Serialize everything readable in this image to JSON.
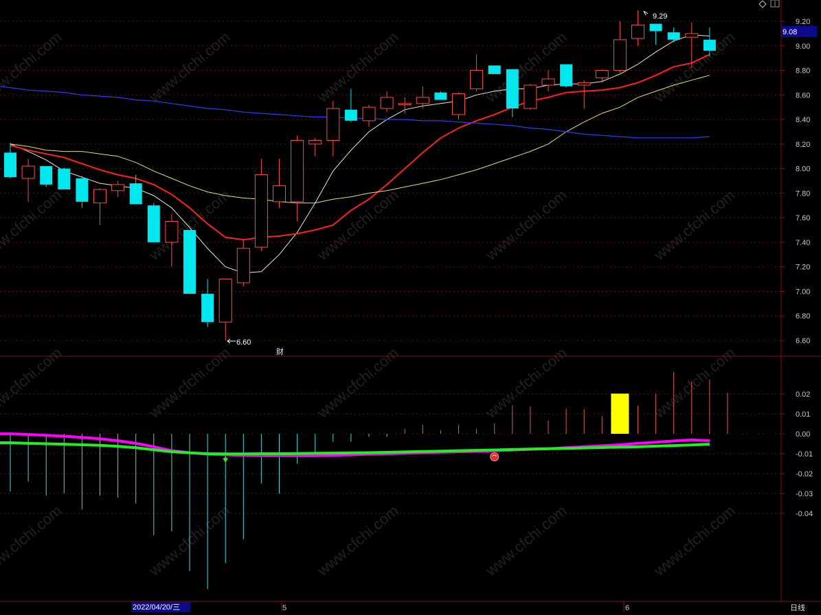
{
  "colors": {
    "background": "#000000",
    "up": "#ff4a4a",
    "down": "#00e8ee",
    "ma5": "#e8e8e8",
    "ma10": "#ff2020",
    "ma20": "#e8e070",
    "ma60": "#2a3cff",
    "grid": "#6a1010",
    "hist_pos": "#e25858",
    "hist_neg": "#44d8e0",
    "hist_highlight": "#ffff00",
    "line_magenta": "#ff00ff",
    "line_green": "#22ee22"
  },
  "toolbar": {
    "diamond_icon": "diamond-icon",
    "menu_icon": "menu-icon"
  },
  "price_tag": "9.08",
  "period_label": "日线",
  "watermark": "www.cfchi.com",
  "x_axis": {
    "date_label": "2022/04/20/三",
    "month_labels": [
      "5",
      "6"
    ]
  },
  "markers": {
    "high_label": "9.29",
    "low_label": "6.60",
    "finance_label": "财"
  },
  "chart_data": [
    {
      "type": "candlestick",
      "title": "",
      "ylim": [
        6.5,
        9.25
      ],
      "y_ticks": [
        "9.20",
        "9.00",
        "8.80",
        "8.60",
        "8.40",
        "8.20",
        "8.00",
        "7.80",
        "7.60",
        "7.40",
        "7.20",
        "7.00",
        "6.80",
        "6.60"
      ],
      "candles": [
        {
          "open": 8.13,
          "high": 8.21,
          "low": 7.92,
          "close": 7.93
        },
        {
          "open": 7.92,
          "high": 8.08,
          "low": 7.73,
          "close": 8.02
        },
        {
          "open": 8.02,
          "high": 8.02,
          "low": 7.85,
          "close": 7.87
        },
        {
          "open": 8.0,
          "high": 8.01,
          "low": 7.83,
          "close": 7.83
        },
        {
          "open": 7.92,
          "high": 7.94,
          "low": 7.68,
          "close": 7.73
        },
        {
          "open": 7.72,
          "high": 7.84,
          "low": 7.54,
          "close": 7.83
        },
        {
          "open": 7.82,
          "high": 7.9,
          "low": 7.77,
          "close": 7.87
        },
        {
          "open": 7.88,
          "high": 7.95,
          "low": 7.71,
          "close": 7.71
        },
        {
          "open": 7.7,
          "high": 7.72,
          "low": 7.4,
          "close": 7.4
        },
        {
          "open": 7.4,
          "high": 7.63,
          "low": 7.2,
          "close": 7.57
        },
        {
          "open": 7.5,
          "high": 7.5,
          "low": 6.98,
          "close": 6.98
        },
        {
          "open": 6.98,
          "high": 7.1,
          "low": 6.71,
          "close": 6.75
        },
        {
          "open": 6.75,
          "high": 7.1,
          "low": 6.6,
          "close": 7.1
        },
        {
          "open": 7.07,
          "high": 7.42,
          "low": 7.04,
          "close": 7.35
        },
        {
          "open": 7.36,
          "high": 8.08,
          "low": 7.33,
          "close": 7.95
        },
        {
          "open": 7.73,
          "high": 8.08,
          "low": 7.68,
          "close": 7.86
        },
        {
          "open": 7.73,
          "high": 8.27,
          "low": 7.57,
          "close": 8.23
        },
        {
          "open": 8.2,
          "high": 8.25,
          "low": 8.1,
          "close": 8.23
        },
        {
          "open": 8.23,
          "high": 8.55,
          "low": 8.1,
          "close": 8.49
        },
        {
          "open": 8.48,
          "high": 8.65,
          "low": 8.38,
          "close": 8.39
        },
        {
          "open": 8.39,
          "high": 8.52,
          "low": 8.34,
          "close": 8.5
        },
        {
          "open": 8.49,
          "high": 8.63,
          "low": 8.46,
          "close": 8.58
        },
        {
          "open": 8.52,
          "high": 8.58,
          "low": 8.45,
          "close": 8.53
        },
        {
          "open": 8.53,
          "high": 8.67,
          "low": 8.49,
          "close": 8.58
        },
        {
          "open": 8.62,
          "high": 8.63,
          "low": 8.56,
          "close": 8.56
        },
        {
          "open": 8.44,
          "high": 8.62,
          "low": 8.4,
          "close": 8.61
        },
        {
          "open": 8.65,
          "high": 8.93,
          "low": 8.63,
          "close": 8.8
        },
        {
          "open": 8.84,
          "high": 8.84,
          "low": 8.77,
          "close": 8.77
        },
        {
          "open": 8.81,
          "high": 8.81,
          "low": 8.42,
          "close": 8.49
        },
        {
          "open": 8.49,
          "high": 8.69,
          "low": 8.48,
          "close": 8.68
        },
        {
          "open": 8.68,
          "high": 8.8,
          "low": 8.63,
          "close": 8.73
        },
        {
          "open": 8.85,
          "high": 8.85,
          "low": 8.66,
          "close": 8.67
        },
        {
          "open": 8.68,
          "high": 8.72,
          "low": 8.49,
          "close": 8.7
        },
        {
          "open": 8.74,
          "high": 8.81,
          "low": 8.7,
          "close": 8.8
        },
        {
          "open": 8.8,
          "high": 9.2,
          "low": 8.78,
          "close": 9.05
        },
        {
          "open": 9.06,
          "high": 9.29,
          "low": 9.0,
          "close": 9.17
        },
        {
          "open": 9.18,
          "high": 9.18,
          "low": 9.01,
          "close": 9.12
        },
        {
          "open": 9.11,
          "high": 9.15,
          "low": 9.03,
          "close": 9.05
        },
        {
          "open": 9.07,
          "high": 9.19,
          "low": 8.82,
          "close": 9.1
        },
        {
          "open": 9.05,
          "high": 9.15,
          "low": 8.91,
          "close": 8.96
        }
      ],
      "series": [
        {
          "name": "MA5",
          "values": [
            8.2,
            8.14,
            8.07,
            7.98,
            7.93,
            7.88,
            7.86,
            7.84,
            7.78,
            7.68,
            7.52,
            7.35,
            7.2,
            7.15,
            7.16,
            7.3,
            7.48,
            7.72,
            7.98,
            8.15,
            8.3,
            8.4,
            8.48,
            8.51,
            8.53,
            8.55,
            8.6,
            8.63,
            8.65,
            8.65,
            8.68,
            8.69,
            8.69,
            8.71,
            8.77,
            8.85,
            8.95,
            9.04,
            9.09,
            9.08
          ]
        },
        {
          "name": "MA10",
          "values": [
            8.19,
            8.15,
            8.12,
            8.09,
            8.04,
            7.99,
            7.95,
            7.92,
            7.87,
            7.79,
            7.68,
            7.55,
            7.44,
            7.42,
            7.44,
            7.45,
            7.47,
            7.5,
            7.54,
            7.66,
            7.75,
            7.87,
            8.0,
            8.13,
            8.25,
            8.33,
            8.39,
            8.44,
            8.5,
            8.55,
            8.58,
            8.62,
            8.63,
            8.64,
            8.66,
            8.7,
            8.76,
            8.83,
            8.86,
            8.93
          ]
        },
        {
          "name": "MA20",
          "values": [
            8.2,
            8.18,
            8.15,
            8.14,
            8.14,
            8.12,
            8.1,
            8.05,
            7.98,
            7.92,
            7.86,
            7.81,
            7.78,
            7.76,
            7.75,
            7.73,
            7.72,
            7.72,
            7.75,
            7.77,
            7.8,
            7.82,
            7.85,
            7.88,
            7.91,
            7.95,
            7.99,
            8.04,
            8.09,
            8.14,
            8.2,
            8.3,
            8.38,
            8.45,
            8.5,
            8.58,
            8.63,
            8.68,
            8.72,
            8.76
          ]
        },
        {
          "name": "MA60",
          "values": [
            8.66,
            8.64,
            8.63,
            8.62,
            8.6,
            8.59,
            8.58,
            8.56,
            8.55,
            8.53,
            8.51,
            8.49,
            8.48,
            8.46,
            8.45,
            8.44,
            8.43,
            8.42,
            8.42,
            8.41,
            8.41,
            8.4,
            8.4,
            8.39,
            8.39,
            8.38,
            8.37,
            8.36,
            8.35,
            8.33,
            8.32,
            8.3,
            8.28,
            8.27,
            8.26,
            8.25,
            8.25,
            8.25,
            8.25,
            8.26
          ]
        }
      ]
    },
    {
      "type": "bar",
      "title": "",
      "ylim": [
        -0.08,
        0.035
      ],
      "y_ticks": [
        "0.02",
        "0.01",
        "0.00",
        "-0.01",
        "-0.02",
        "-0.03",
        "-0.04"
      ],
      "values": [
        -0.029,
        -0.024,
        -0.031,
        -0.03,
        -0.038,
        -0.031,
        -0.032,
        -0.035,
        -0.051,
        -0.049,
        -0.069,
        -0.078,
        -0.065,
        -0.053,
        -0.025,
        -0.03,
        -0.015,
        -0.01,
        -0.004,
        -0.004,
        -0.0015,
        -0.0015,
        0.0025,
        0.0045,
        0.0018,
        0.0045,
        0.0025,
        0.0052,
        0.0143,
        0.0137,
        0.0066,
        0.0127,
        0.0123,
        0.0089,
        0.0102,
        0.0142,
        0.0202,
        0.0311,
        0.0262,
        0.0272,
        0.0206
      ],
      "highlight_bar": {
        "index": 34,
        "value": 0.0202
      },
      "series": [
        {
          "name": "",
          "values": [
            0.0,
            -0.0003,
            -0.0008,
            -0.0012,
            -0.0018,
            -0.0025,
            -0.0035,
            -0.0048,
            -0.0065,
            -0.0085,
            -0.0095,
            -0.0102,
            -0.0105,
            -0.0108,
            -0.011,
            -0.011,
            -0.011,
            -0.011,
            -0.0108,
            -0.0105,
            -0.0102,
            -0.01,
            -0.0098,
            -0.0095,
            -0.0092,
            -0.009,
            -0.0088,
            -0.0085,
            -0.0082,
            -0.0078,
            -0.0075,
            -0.007,
            -0.0065,
            -0.006,
            -0.0055,
            -0.0048,
            -0.0042,
            -0.0036,
            -0.003,
            -0.0035
          ]
        },
        {
          "name": "",
          "values": [
            -0.0045,
            -0.0048,
            -0.005,
            -0.0052,
            -0.0055,
            -0.0058,
            -0.0063,
            -0.007,
            -0.008,
            -0.009,
            -0.0096,
            -0.01,
            -0.0101,
            -0.0101,
            -0.01,
            -0.01,
            -0.0099,
            -0.0098,
            -0.0097,
            -0.0096,
            -0.0095,
            -0.0093,
            -0.0091,
            -0.0089,
            -0.0087,
            -0.0085,
            -0.0083,
            -0.0081,
            -0.0079,
            -0.0077,
            -0.0075,
            -0.0073,
            -0.0071,
            -0.0069,
            -0.0067,
            -0.0065,
            -0.0062,
            -0.0059,
            -0.0056,
            -0.0052
          ]
        }
      ],
      "signal_markers": [
        {
          "type": "down-arrow",
          "index": 12
        },
        {
          "type": "red-ball",
          "index": 27
        }
      ]
    }
  ]
}
